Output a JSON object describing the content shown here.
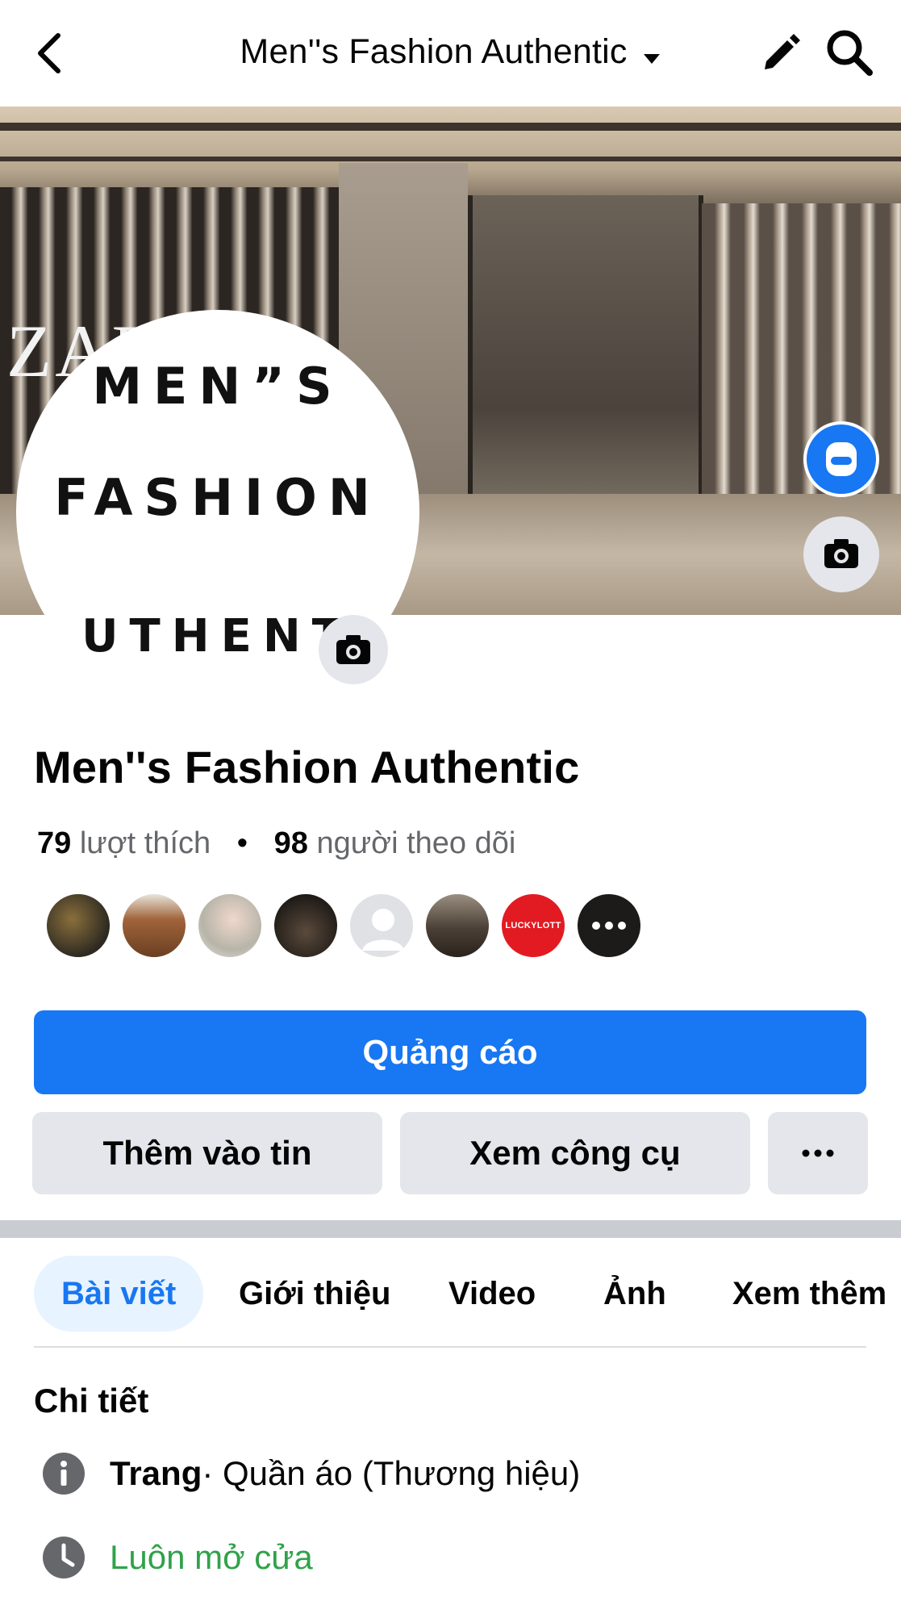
{
  "header": {
    "title": "Men''s Fashion Authentic"
  },
  "cover": {
    "brand_text": "ZAR",
    "accent_color": "#1877f2"
  },
  "avatar": {
    "line1": "MEN”S",
    "line2": "FASHION",
    "line3": "UTHENT"
  },
  "profile": {
    "name": "Men''s Fashion Authentic",
    "likes_count": "79",
    "likes_label": "lượt thích",
    "followers_count": "98",
    "followers_label": "người theo dõi"
  },
  "follower_avatars": [
    {
      "icon": "follower-avatar-1"
    },
    {
      "icon": "follower-avatar-2"
    },
    {
      "icon": "follower-avatar-3"
    },
    {
      "icon": "follower-avatar-4"
    },
    {
      "icon": "follower-avatar-default"
    },
    {
      "icon": "follower-avatar-6"
    },
    {
      "icon": "follower-avatar-luckylott",
      "label": "LUCKYLOTT"
    },
    {
      "icon": "more-followers"
    }
  ],
  "actions": {
    "promote_label": "Quảng cáo",
    "add_to_story_label": "Thêm vào tin",
    "view_tools_label": "Xem công cụ"
  },
  "tabs": [
    {
      "label": "Bài viết",
      "active": true
    },
    {
      "label": "Giới thiệu",
      "active": false
    },
    {
      "label": "Video",
      "active": false
    },
    {
      "label": "Ảnh",
      "active": false
    },
    {
      "label": "Xem thêm",
      "active": false
    }
  ],
  "details": {
    "title": "Chi tiết",
    "page_type_bold": "Trang",
    "page_type_rest": " · Quần áo (Thương hiệu)",
    "hours": "Luôn mở cửa"
  }
}
